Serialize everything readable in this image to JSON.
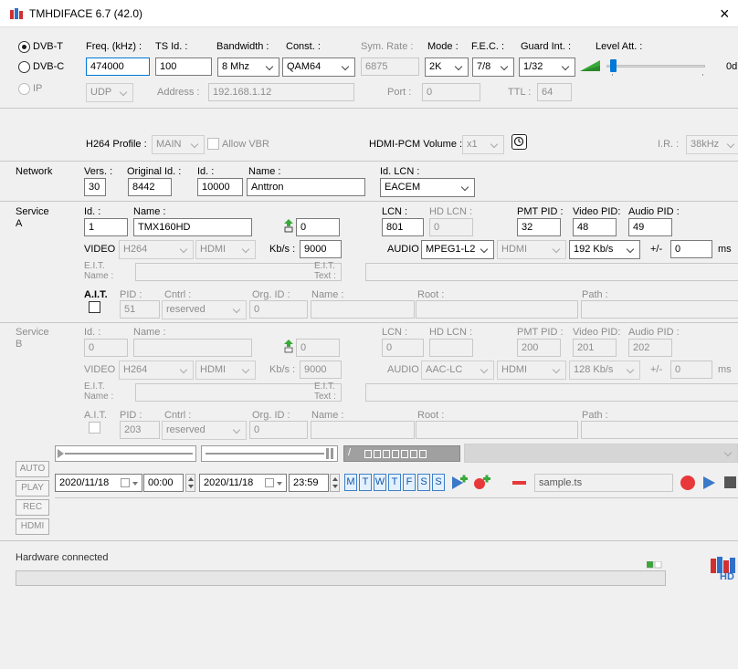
{
  "window": {
    "title": "TMHDIFACE 6.7 (42.0)",
    "close": "×"
  },
  "tuner": {
    "dvbt": "DVB-T",
    "dvbc": "DVB-C",
    "ip": "IP",
    "freq_label": "Freq. (kHz) :",
    "freq_value": "474000",
    "tsid_label": "TS Id. :",
    "tsid_value": "100",
    "bw_label": "Bandwidth :",
    "bw_value": "8 Mhz",
    "const_label": "Const. :",
    "const_value": "QAM64",
    "symrate_label": "Sym. Rate :",
    "symrate_value": "6875",
    "mode_label": "Mode :",
    "mode_value": "2K",
    "fec_label": "F.E.C. :",
    "fec_value": "7/8",
    "guard_label": "Guard Int. :",
    "guard_value": "1/32",
    "level_label": "Level Att. :",
    "level_value": "0d",
    "udp_value": "UDP",
    "address_label": "Address :",
    "address_value": "192.168.1.12",
    "port_label": "Port :",
    "port_value": "0",
    "ttl_label": "TTL :",
    "ttl_value": "64"
  },
  "profile": {
    "h264_label": "H264 Profile :",
    "h264_value": "MAIN",
    "allow_vbr": "Allow VBR",
    "hdmi_vol_label": "HDMI-PCM Volume :",
    "hdmi_vol_value": "x1",
    "ir_label": "I.R. :",
    "ir_value": "38kHz"
  },
  "network": {
    "title": "Network",
    "vers_label": "Vers. :",
    "vers_value": "30",
    "orig_label": "Original Id. :",
    "orig_value": "8442",
    "id_label": "Id. :",
    "id_value": "10000",
    "name_label": "Name :",
    "name_value": "Anttron",
    "lcn_label": "Id. LCN :",
    "lcn_value": "EACEM"
  },
  "serviceA": {
    "title1": "Service",
    "title2": "A",
    "id_label": "Id. :",
    "id_value": "1",
    "name_label": "Name :",
    "name_value": "TMX160HD",
    "num_value": "0",
    "lcn_label": "LCN :",
    "lcn_value": "801",
    "hdlcn_label": "HD LCN :",
    "hdlcn_value": "0",
    "pmt_label": "PMT PID :",
    "pmt_value": "32",
    "vpid_label": "Video PID:",
    "vpid_value": "48",
    "apid_label": "Audio PID :",
    "apid_value": "49",
    "video_label": "VIDEO",
    "video_codec": "H264",
    "video_src": "HDMI",
    "kbs_label": "Kb/s :",
    "kbs_value": "9000",
    "audio_label": "AUDIO",
    "audio_codec": "MPEG1-L2",
    "audio_src": "HDMI",
    "audio_rate": "192 Kb/s",
    "pm_label": "+/-",
    "pm_value": "0",
    "ms_label": "ms",
    "eit_name1": "E.I.T.",
    "eit_name2": "Name :",
    "eit_text1": "E.I.T.",
    "eit_text2": "Text :",
    "ait_label": "A.I.T.",
    "pid_label": "PID :",
    "pid_value": "51",
    "cntrl_label": "Cntrl :",
    "cntrl_value": "reserved",
    "orgid_label": "Org. ID :",
    "orgid_value": "0",
    "name2_label": "Name :",
    "root_label": "Root :",
    "path_label": "Path :"
  },
  "serviceB": {
    "title1": "Service",
    "title2": "B",
    "id_label": "Id. :",
    "id_value": "0",
    "name_label": "Name :",
    "num_value": "0",
    "lcn_label": "LCN :",
    "lcn_value": "0",
    "hdlcn_label": "HD LCN :",
    "pmt_label": "PMT PID :",
    "pmt_value": "200",
    "vpid_label": "Video PID:",
    "vpid_value": "201",
    "apid_label": "Audio PID :",
    "apid_value": "202",
    "video_label": "VIDEO",
    "video_codec": "H264",
    "video_src": "HDMI",
    "kbs_label": "Kb/s :",
    "kbs_value": "9000",
    "audio_label": "AUDIO",
    "audio_codec": "AAC-LC",
    "audio_src": "HDMI",
    "audio_rate": "128 Kb/s",
    "pm_label": "+/-",
    "pm_value": "0",
    "ms_label": "ms",
    "eit_name1": "E.I.T.",
    "eit_name2": "Name :",
    "eit_text1": "E.I.T.",
    "eit_text2": "Text :",
    "ait_label": "A.I.T.",
    "pid_label": "PID :",
    "pid_value": "203",
    "cntrl_label": "Cntrl :",
    "cntrl_value": "reserved",
    "orgid_label": "Org. ID :",
    "orgid_value": "0",
    "name2_label": "Name :",
    "root_label": "Root :",
    "path_label": "Path :"
  },
  "scheduler": {
    "start_date": "2020/11/18",
    "start_time": "00:00",
    "end_date": "2020/11/18",
    "end_time": "23:59",
    "days": [
      "M",
      "T",
      "W",
      "T",
      "F",
      "S",
      "S"
    ],
    "file": "sample.ts"
  },
  "side_buttons": [
    "AUTO",
    "PLAY",
    "REC",
    "HDMI"
  ],
  "status": {
    "text": "Hardware connected",
    "logo_text": "HD"
  },
  "colors": {
    "accent": "#0078d7",
    "record_red": "#e8383a",
    "play_blue": "#3a78c8",
    "add_green": "#3aa83a"
  }
}
